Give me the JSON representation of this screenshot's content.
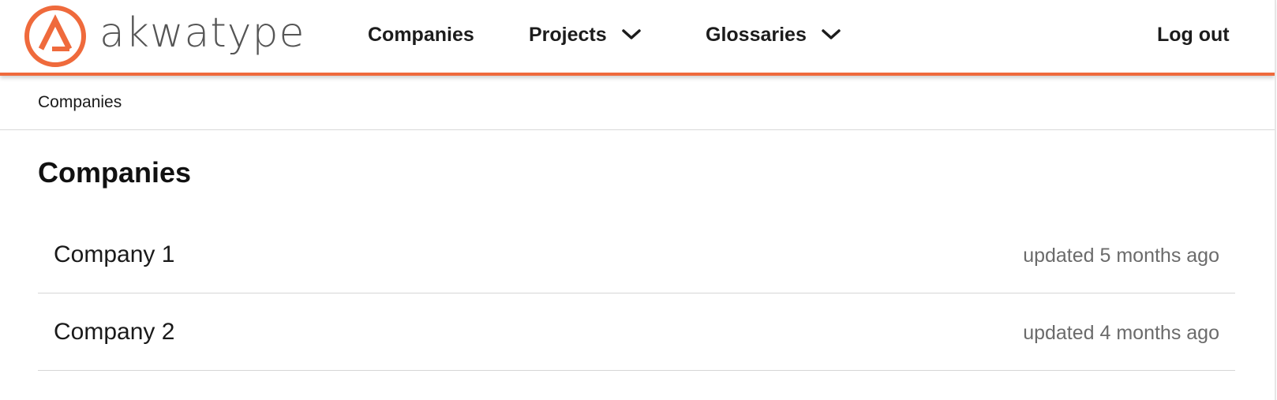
{
  "brand": {
    "name": "akwatype",
    "accent_color": "#ef6a3c",
    "logo_icon": "akwatype-logo-icon"
  },
  "nav": {
    "companies": "Companies",
    "projects": "Projects",
    "glossaries": "Glossaries",
    "logout": "Log out",
    "dropdown_icon": "chevron-down-icon"
  },
  "breadcrumb": {
    "current": "Companies"
  },
  "main": {
    "title": "Companies",
    "companies": [
      {
        "name": "Company 1",
        "updated": "updated 5 months ago"
      },
      {
        "name": "Company 2",
        "updated": "updated 4 months ago"
      }
    ]
  }
}
